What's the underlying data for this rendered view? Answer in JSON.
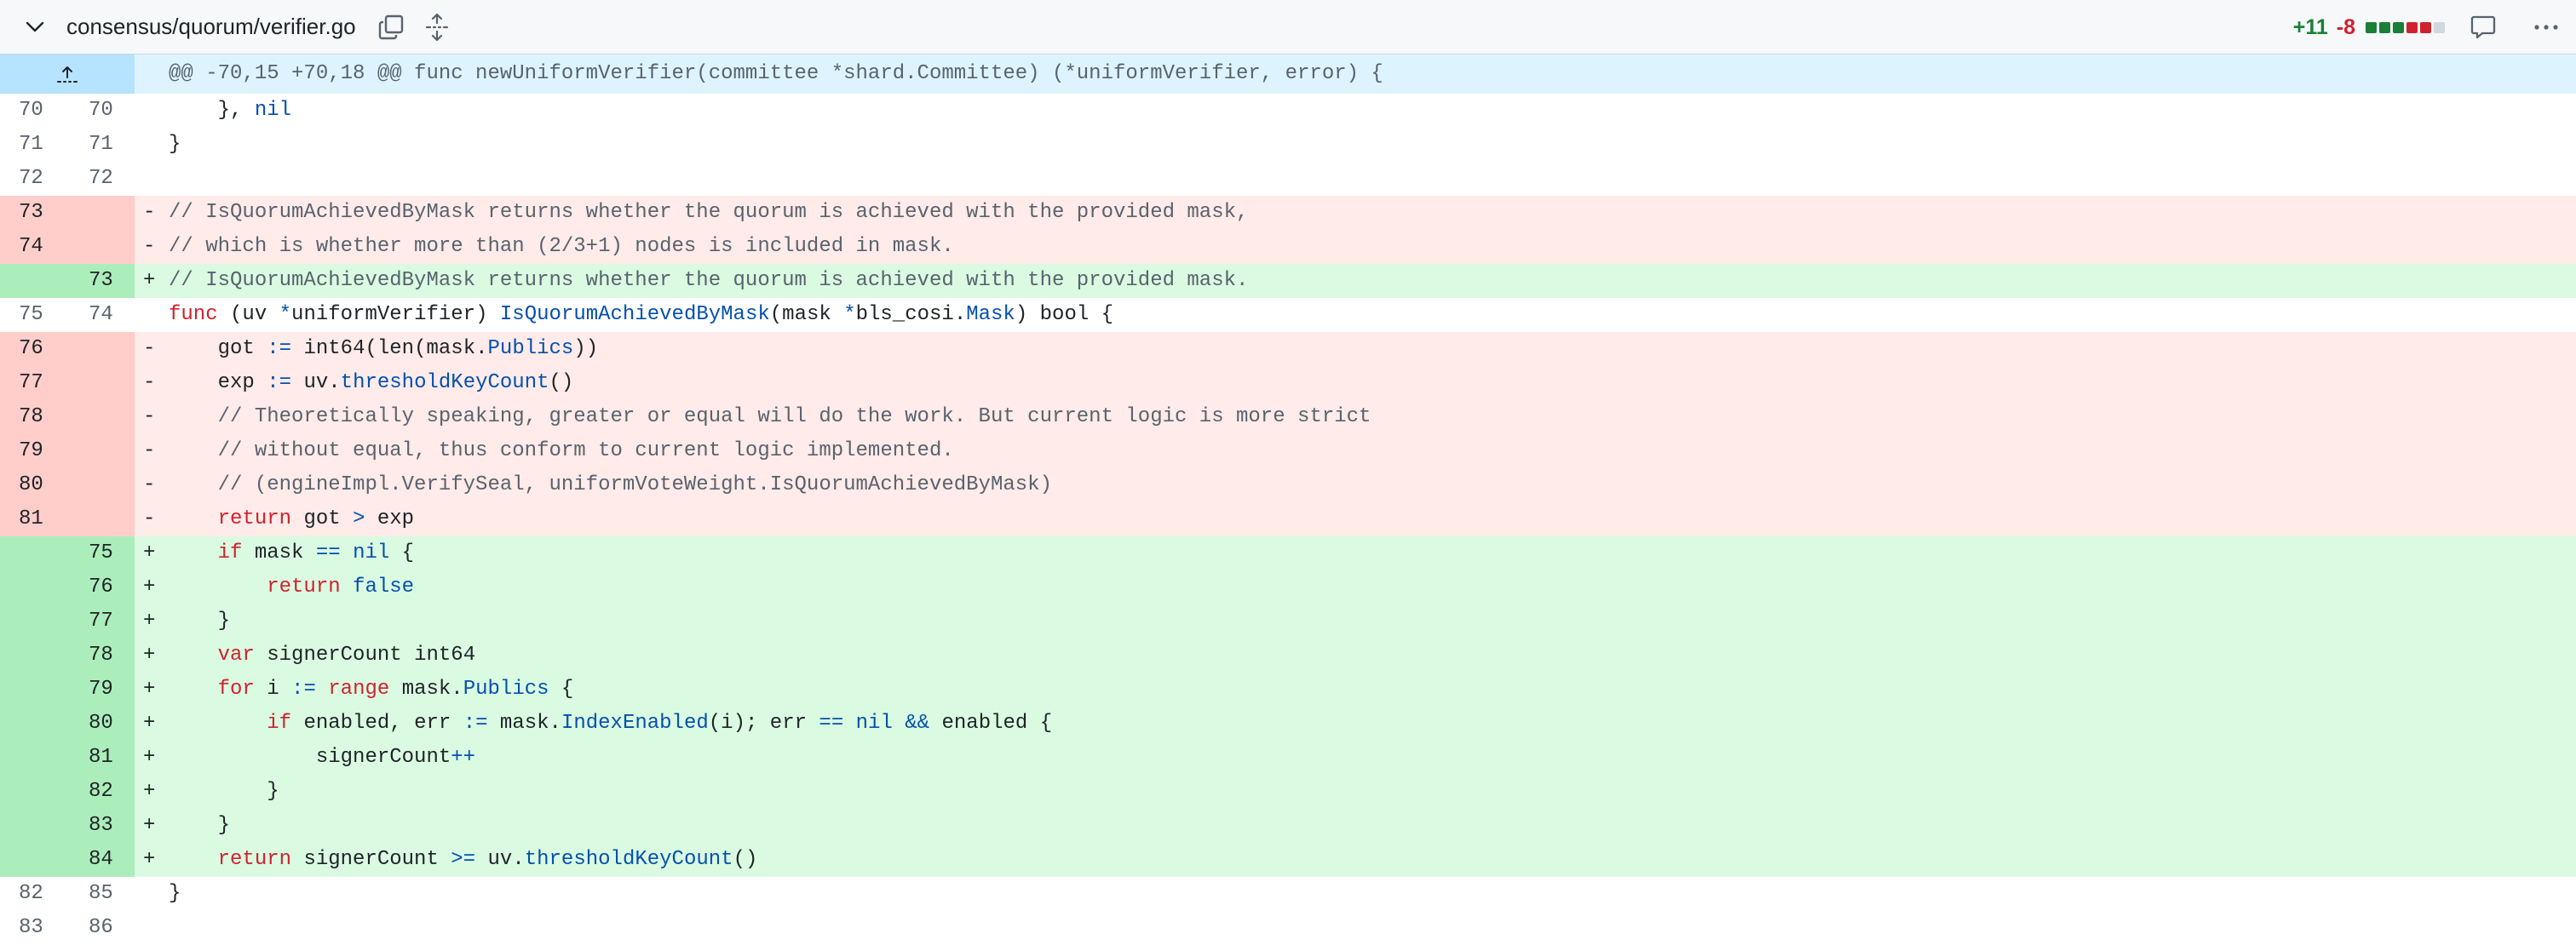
{
  "file": {
    "path": "consensus/quorum/verifier.go",
    "additions": "+11",
    "deletions": "-8",
    "diffstat": [
      "#1a7f37",
      "#1a7f37",
      "#1a7f37",
      "#cf222e",
      "#cf222e",
      "#d0d7de"
    ]
  },
  "icons": {
    "collapse": "chevron-down-icon",
    "copy": "copy-icon",
    "expand": "expand-all-icon",
    "comment": "comment-icon",
    "more": "kebab-horizontal-icon",
    "hunk_expand": "expand-up-icon"
  },
  "hunk": {
    "header": "@@ -70,15 +70,18 @@ func newUniformVerifier(committee *shard.Committee) (*uniformVerifier, error) {"
  },
  "lines": [
    {
      "type": "ctx",
      "old": "70",
      "new": "70",
      "sign": "",
      "text": "    }, nil"
    },
    {
      "type": "ctx",
      "old": "71",
      "new": "71",
      "sign": "",
      "text": "}"
    },
    {
      "type": "ctx",
      "old": "72",
      "new": "72",
      "sign": "",
      "text": ""
    },
    {
      "type": "del",
      "old": "73",
      "new": "",
      "sign": "-",
      "text": "// IsQuorumAchievedByMask returns whether the quorum is achieved with the provided mask,"
    },
    {
      "type": "del",
      "old": "74",
      "new": "",
      "sign": "-",
      "text": "// which is whether more than (2/3+1) nodes is included in mask."
    },
    {
      "type": "add",
      "old": "",
      "new": "73",
      "sign": "+",
      "text": "// IsQuorumAchievedByMask returns whether the quorum is achieved with the provided mask."
    },
    {
      "type": "ctx",
      "old": "75",
      "new": "74",
      "sign": "",
      "text": "func (uv *uniformVerifier) IsQuorumAchievedByMask(mask *bls_cosi.Mask) bool {"
    },
    {
      "type": "del",
      "old": "76",
      "new": "",
      "sign": "-",
      "text": "    got := int64(len(mask.Publics))"
    },
    {
      "type": "del",
      "old": "77",
      "new": "",
      "sign": "-",
      "text": "    exp := uv.thresholdKeyCount()"
    },
    {
      "type": "del",
      "old": "78",
      "new": "",
      "sign": "-",
      "text": "    // Theoretically speaking, greater or equal will do the work. But current logic is more strict"
    },
    {
      "type": "del",
      "old": "79",
      "new": "",
      "sign": "-",
      "text": "    // without equal, thus conform to current logic implemented."
    },
    {
      "type": "del",
      "old": "80",
      "new": "",
      "sign": "-",
      "text": "    // (engineImpl.VerifySeal, uniformVoteWeight.IsQuorumAchievedByMask)"
    },
    {
      "type": "del",
      "old": "81",
      "new": "",
      "sign": "-",
      "text": "    return got > exp"
    },
    {
      "type": "add",
      "old": "",
      "new": "75",
      "sign": "+",
      "text": "    if mask == nil {"
    },
    {
      "type": "add",
      "old": "",
      "new": "76",
      "sign": "+",
      "text": "        return false"
    },
    {
      "type": "add",
      "old": "",
      "new": "77",
      "sign": "+",
      "text": "    }"
    },
    {
      "type": "add",
      "old": "",
      "new": "78",
      "sign": "+",
      "text": "    var signerCount int64"
    },
    {
      "type": "add",
      "old": "",
      "new": "79",
      "sign": "+",
      "text": "    for i := range mask.Publics {"
    },
    {
      "type": "add",
      "old": "",
      "new": "80",
      "sign": "+",
      "text": "        if enabled, err := mask.IndexEnabled(i); err == nil && enabled {"
    },
    {
      "type": "add",
      "old": "",
      "new": "81",
      "sign": "+",
      "text": "            signerCount++"
    },
    {
      "type": "add",
      "old": "",
      "new": "82",
      "sign": "+",
      "text": "        }"
    },
    {
      "type": "add",
      "old": "",
      "new": "83",
      "sign": "+",
      "text": "    }"
    },
    {
      "type": "add",
      "old": "",
      "new": "84",
      "sign": "+",
      "text": "    return signerCount >= uv.thresholdKeyCount()"
    },
    {
      "type": "ctx",
      "old": "82",
      "new": "85",
      "sign": "",
      "text": "}"
    },
    {
      "type": "ctx",
      "old": "83",
      "new": "86",
      "sign": "",
      "text": ""
    }
  ]
}
